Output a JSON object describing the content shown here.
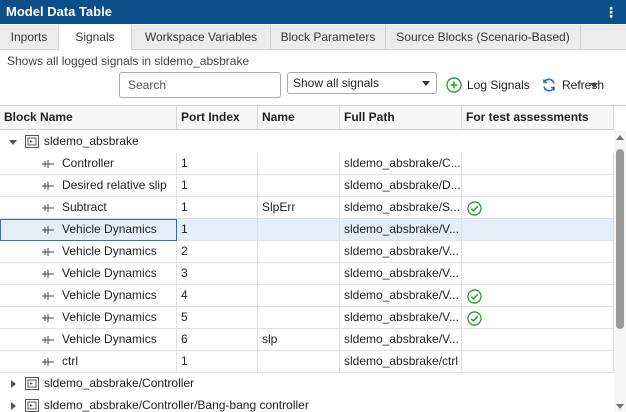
{
  "window": {
    "title": "Model Data Table",
    "menu_glyph": "⋮"
  },
  "tabs": [
    {
      "label": "Inports",
      "active": false
    },
    {
      "label": "Signals",
      "active": true
    },
    {
      "label": "Workspace Variables",
      "active": false
    },
    {
      "label": "Block Parameters",
      "active": false
    },
    {
      "label": "Source Blocks (Scenario-Based)",
      "active": false
    }
  ],
  "description": "Shows all logged signals in sldemo_absbrake",
  "toolbar": {
    "search_placeholder": "Search",
    "filter_value": "Show all signals",
    "log_signals_label": "Log Signals",
    "refresh_label": "Refresh",
    "accent_color": "#2e9b3a",
    "refresh_color": "#2a6ebb"
  },
  "table": {
    "columns": [
      "Block Name",
      "Port Index",
      "Name",
      "Full Path",
      "For test assessments"
    ],
    "groups": [
      {
        "label": "sldemo_absbrake",
        "expanded": true
      },
      {
        "label": "sldemo_absbrake/Controller",
        "expanded": false
      },
      {
        "label": "sldemo_absbrake/Controller/Bang-bang controller",
        "expanded": false
      }
    ],
    "rows": [
      {
        "block": "Controller",
        "port": "1",
        "name": "",
        "path": "sldemo_absbrake/C...",
        "test": false,
        "selected": false
      },
      {
        "block": "Desired relative slip",
        "port": "1",
        "name": "",
        "path": "sldemo_absbrake/D...",
        "test": false,
        "selected": false
      },
      {
        "block": "Subtract",
        "port": "1",
        "name": "SlpErr",
        "path": "sldemo_absbrake/S...",
        "test": true,
        "selected": false
      },
      {
        "block": "Vehicle Dynamics",
        "port": "1",
        "name": "",
        "path": "sldemo_absbrake/V...",
        "test": false,
        "selected": true
      },
      {
        "block": "Vehicle Dynamics",
        "port": "2",
        "name": "",
        "path": "sldemo_absbrake/V...",
        "test": false,
        "selected": false
      },
      {
        "block": "Vehicle Dynamics",
        "port": "3",
        "name": "",
        "path": "sldemo_absbrake/V...",
        "test": false,
        "selected": false
      },
      {
        "block": "Vehicle Dynamics",
        "port": "4",
        "name": "",
        "path": "sldemo_absbrake/V...",
        "test": true,
        "selected": false
      },
      {
        "block": "Vehicle Dynamics",
        "port": "5",
        "name": "",
        "path": "sldemo_absbrake/V...",
        "test": true,
        "selected": false
      },
      {
        "block": "Vehicle Dynamics",
        "port": "6",
        "name": "slp",
        "path": "sldemo_absbrake/V...",
        "test": false,
        "selected": false
      },
      {
        "block": "ctrl",
        "port": "1",
        "name": "",
        "path": "sldemo_absbrake/ctrl",
        "test": false,
        "selected": false
      }
    ],
    "icons": {
      "block": "subsystem-block-icon",
      "signal": "logged-signal-icon",
      "test": "check-circle-icon"
    }
  }
}
